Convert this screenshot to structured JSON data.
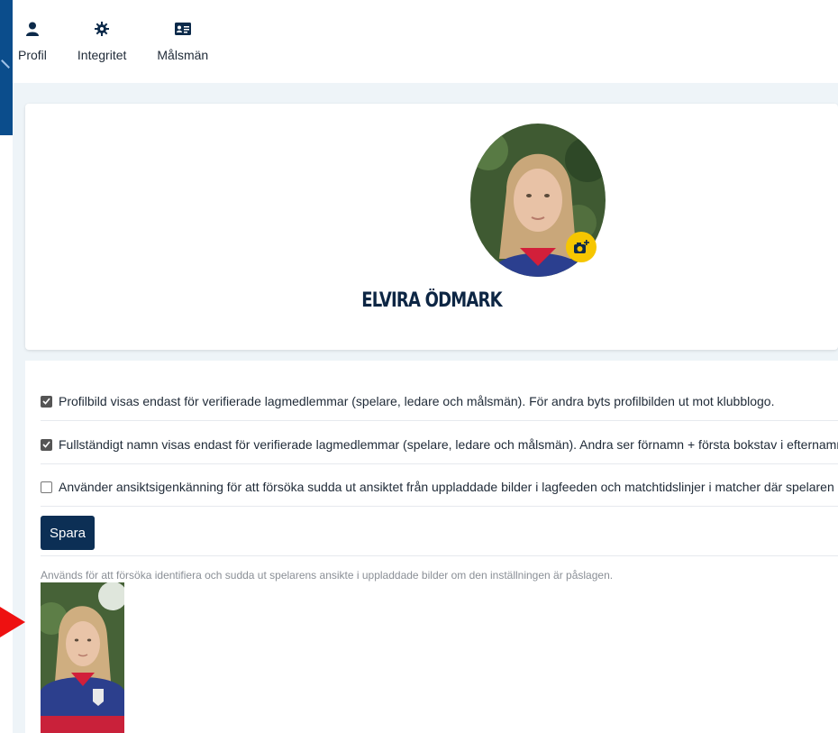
{
  "tabs": [
    {
      "label": "Profil",
      "icon": "user-icon"
    },
    {
      "label": "Integritet",
      "icon": "gear-icon"
    },
    {
      "label": "Målsmän",
      "icon": "id-card-icon"
    }
  ],
  "profile": {
    "name": "ELVIRA ÖDMARK",
    "avatar_icon": "avatar-photo",
    "camera_icon": "camera-plus-icon"
  },
  "options": [
    {
      "checked": true,
      "label": "Profilbild visas endast för verifierade lagmedlemmar (spelare, ledare och målsmän). För andra byts profilbilden ut mot klubblogo."
    },
    {
      "checked": true,
      "label": "Fullständigt namn visas endast för verifierade lagmedlemmar (spelare, ledare och målsmän). Andra ser förnamn + första bokstav i efternamn."
    },
    {
      "checked": false,
      "label": "Använder ansiktsigenkänning för att försöka sudda ut ansiktet från uppladdade bilder i lagfeeden och matchtidslinjer i matcher där spelaren deltar."
    }
  ],
  "save_label": "Spara",
  "help_text": "Används för att försöka identifiera och sudda ut spelarens ansikte i uppladdade bilder om den inställningen är påslagen.",
  "colors": {
    "accent": "#0c2f55",
    "camera": "#f6c600",
    "arrow": "#ee1111"
  }
}
